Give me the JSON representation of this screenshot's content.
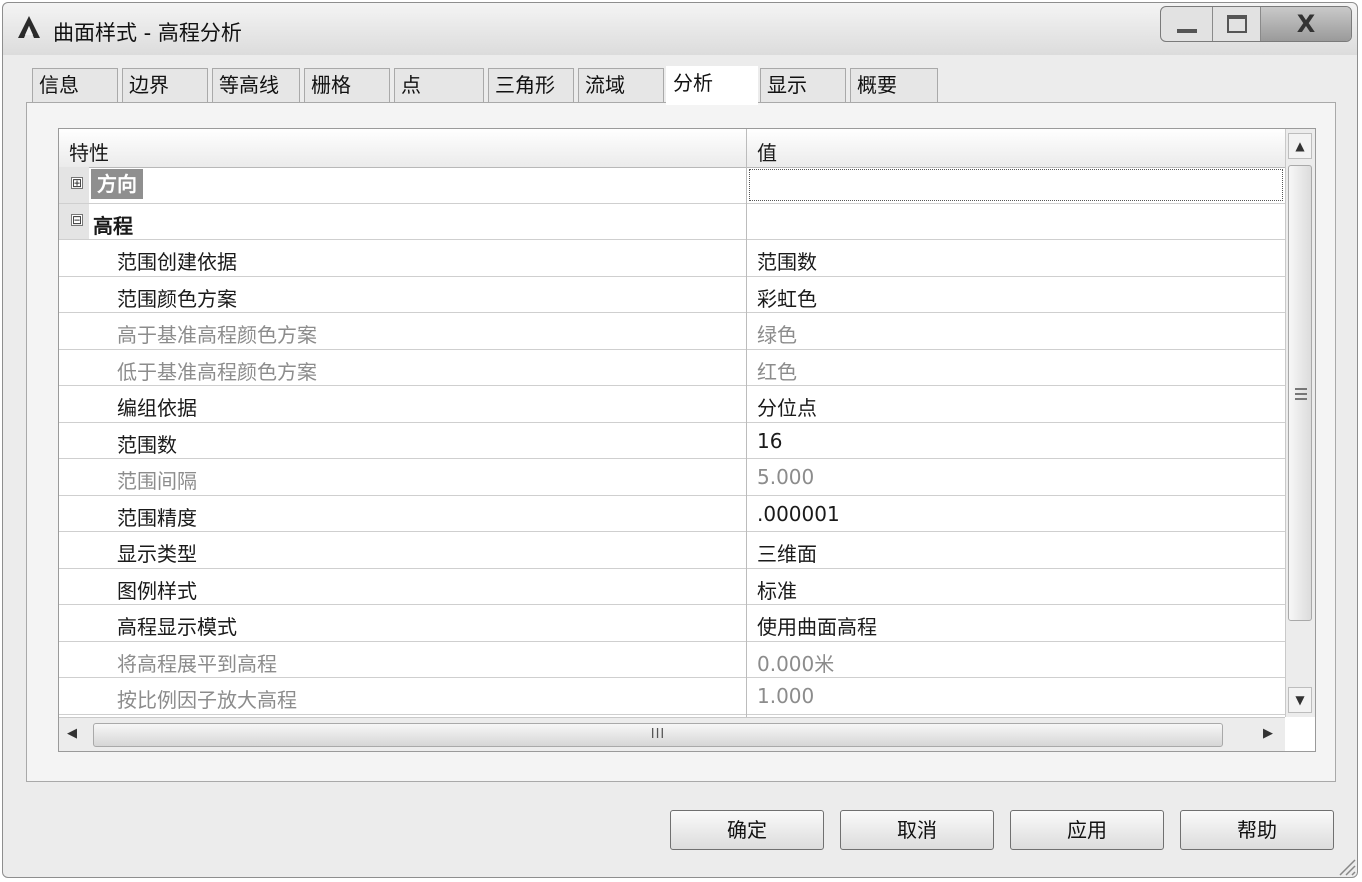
{
  "window": {
    "title": "曲面样式 - 高程分析",
    "close_glyph": "X"
  },
  "tabs": [
    {
      "label": "信息"
    },
    {
      "label": "边界"
    },
    {
      "label": "等高线"
    },
    {
      "label": "栅格"
    },
    {
      "label": "点"
    },
    {
      "label": "三角形"
    },
    {
      "label": "流域"
    },
    {
      "label": "分析",
      "active": true
    },
    {
      "label": "显示"
    },
    {
      "label": "概要"
    }
  ],
  "grid": {
    "header_property": "特性",
    "header_value": "值",
    "categories": [
      {
        "label": "方向",
        "expander": "⊞",
        "selected": true
      },
      {
        "label": "高程",
        "expander": "⊟"
      }
    ],
    "rows": [
      {
        "property": "范围创建依据",
        "value": "范围数",
        "disabled": false
      },
      {
        "property": "范围颜色方案",
        "value": "彩虹色",
        "disabled": false
      },
      {
        "property": "高于基准高程颜色方案",
        "value": "绿色",
        "disabled": true
      },
      {
        "property": "低于基准高程颜色方案",
        "value": "红色",
        "disabled": true
      },
      {
        "property": "编组依据",
        "value": "分位点",
        "disabled": false
      },
      {
        "property": "范围数",
        "value": "16",
        "disabled": false
      },
      {
        "property": "范围间隔",
        "value": "5.000",
        "disabled": true
      },
      {
        "property": "范围精度",
        "value": ".000001",
        "disabled": false
      },
      {
        "property": "显示类型",
        "value": "三维面",
        "disabled": false
      },
      {
        "property": "图例样式",
        "value": "标准",
        "disabled": false
      },
      {
        "property": "高程显示模式",
        "value": "使用曲面高程",
        "disabled": false
      },
      {
        "property": "将高程展平到高程",
        "value": "0.000米",
        "disabled": true
      },
      {
        "property": "按比例因子放大高程",
        "value": "1.000",
        "disabled": true
      }
    ],
    "hscroll_grip": "III"
  },
  "buttons": {
    "ok": "确定",
    "cancel": "取消",
    "apply": "应用",
    "help": "帮助"
  }
}
